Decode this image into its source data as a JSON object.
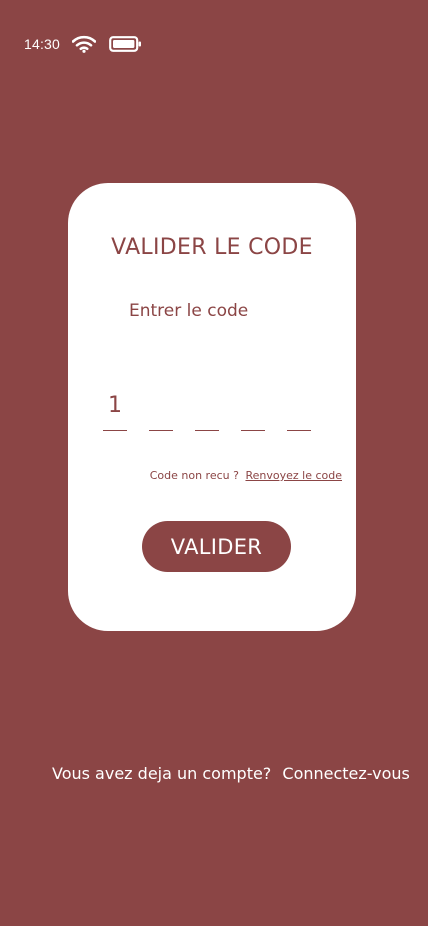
{
  "status_bar": {
    "time": "14:30",
    "wifi_icon": "wifi-icon",
    "battery_icon": "battery-icon"
  },
  "card": {
    "title": "VALIDER LE CODE",
    "code_label": "Entrer le code",
    "digits": [
      "1",
      "",
      "",
      "",
      ""
    ],
    "resend_question": "Code non recu ?",
    "resend_link": "Renvoyez le code",
    "validate_label": "VALIDER"
  },
  "footer": {
    "question": "Vous avez deja un compte?",
    "login_link": "Connectez-vous"
  },
  "colors": {
    "background": "#8B4545",
    "card": "#ffffff",
    "accent": "#8B4545"
  }
}
